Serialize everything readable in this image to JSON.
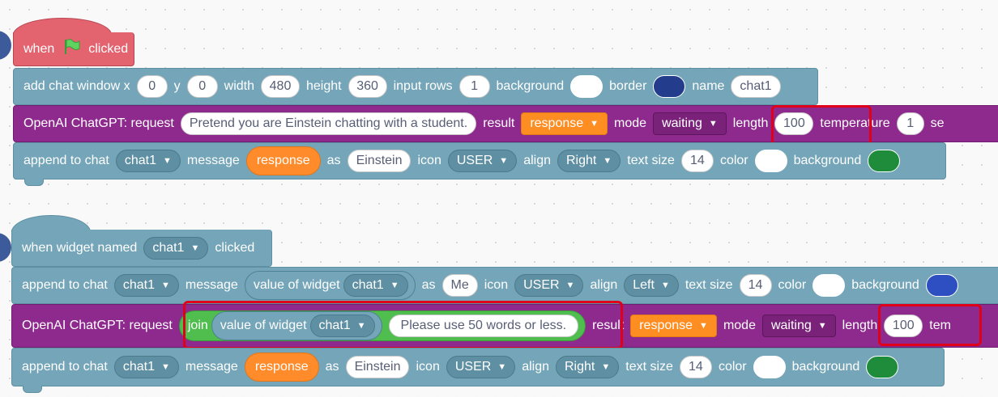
{
  "script1": {
    "when_clicked": {
      "when": "when",
      "clicked": "clicked"
    },
    "add_chat_window": {
      "label": "add chat window x",
      "x": "0",
      "y_label": "y",
      "y": "0",
      "width_label": "width",
      "width": "480",
      "height_label": "height",
      "height": "360",
      "input_rows_label": "input rows",
      "input_rows": "1",
      "background_label": "background",
      "background_color": "#ffffff",
      "border_label": "border",
      "border_color": "#243c8c",
      "name_label": "name",
      "name": "chat1"
    },
    "request": {
      "label": "OpenAI ChatGPT: request",
      "prompt": "Pretend you are Einstein chatting with a student.",
      "result_label": "result",
      "result": "response",
      "mode_label": "mode",
      "mode": "waiting",
      "length_label": "length",
      "length": "100",
      "temperature_label": "temperature",
      "temperature": "1",
      "trail": "se"
    },
    "append": {
      "label": "append to chat",
      "chat": "chat1",
      "message_label": "message",
      "message": "response",
      "as_label": "as",
      "as": "Einstein",
      "icon_label": "icon",
      "icon": "USER",
      "align_label": "align",
      "align": "Right",
      "text_size_label": "text size",
      "text_size": "14",
      "color_label": "color",
      "color": "#ffffff",
      "background_label": "background",
      "background_color": "#1e8c3a"
    }
  },
  "script2": {
    "when_widget": {
      "label": "when widget named",
      "widget": "chat1",
      "clicked": "clicked"
    },
    "append1": {
      "label": "append to chat",
      "chat": "chat1",
      "message_label": "message",
      "value_of_widget": "value of widget",
      "value_widget": "chat1",
      "as_label": "as",
      "as": "Me",
      "icon_label": "icon",
      "icon": "USER",
      "align_label": "align",
      "align": "Left",
      "text_size_label": "text size",
      "text_size": "14",
      "color_label": "color",
      "color": "#ffffff",
      "background_label": "background",
      "background_color": "#2d4fc2"
    },
    "request": {
      "label": "OpenAI ChatGPT: request",
      "join": "join",
      "value_of_widget": "value of widget",
      "value_widget": "chat1",
      "suffix": "Please use 50 words or less.",
      "result_label": "result",
      "result": "response",
      "mode_label": "mode",
      "mode": "waiting",
      "length_label": "length",
      "length": "100",
      "trail": "tem"
    },
    "append2": {
      "label": "append to chat",
      "chat": "chat1",
      "message_label": "message",
      "message": "response",
      "as_label": "as",
      "as": "Einstein",
      "icon_label": "icon",
      "icon": "USER",
      "align_label": "align",
      "align": "Right",
      "text_size_label": "text size",
      "text_size": "14",
      "color_label": "color",
      "color": "#ffffff",
      "background_label": "background",
      "background_color": "#1e8c3a"
    }
  }
}
